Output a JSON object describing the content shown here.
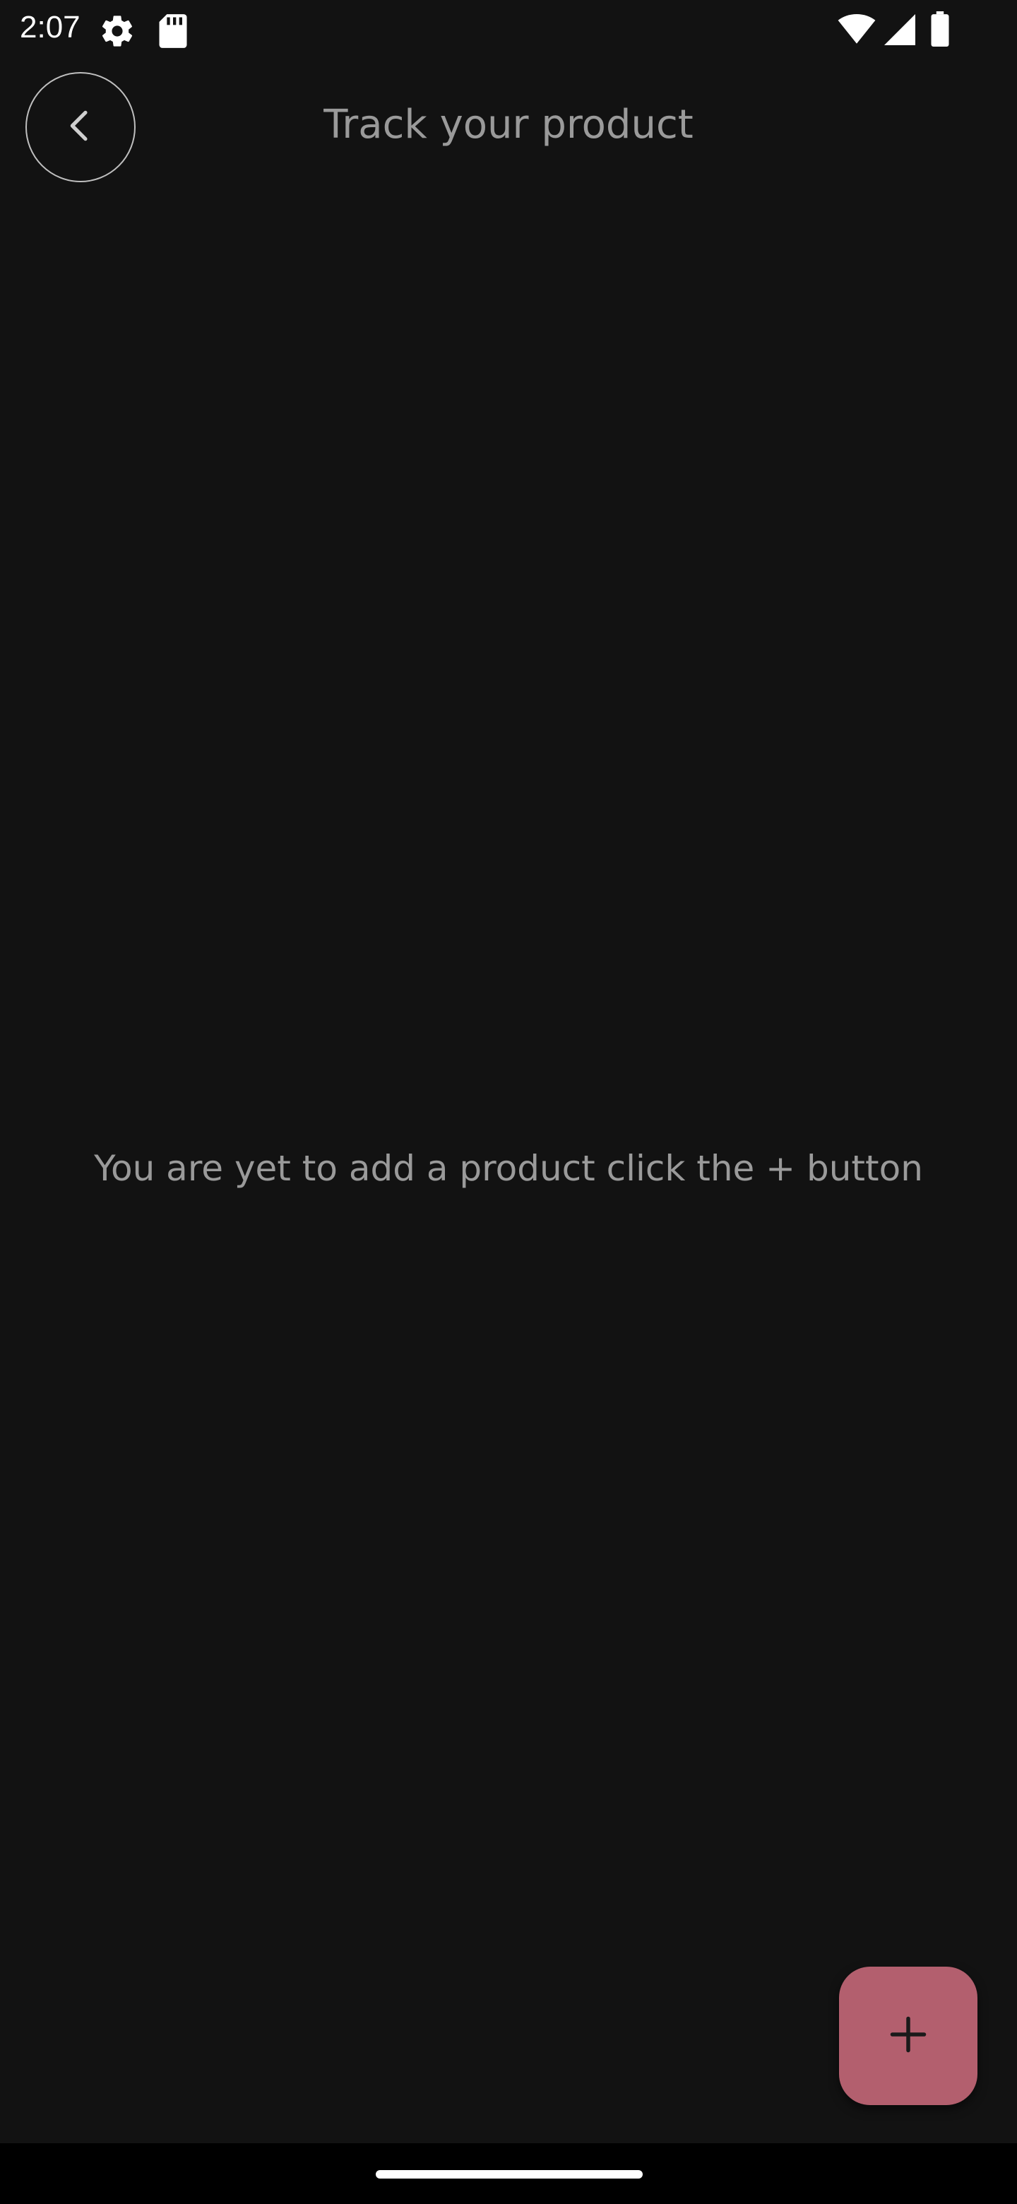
{
  "status_bar": {
    "time": "2:07",
    "icons": [
      "settings-gear-icon",
      "sd-card-icon",
      "wifi-icon",
      "cell-signal-icon",
      "battery-icon"
    ]
  },
  "header": {
    "back_icon": "chevron-left-icon",
    "title": "Track your product"
  },
  "main": {
    "empty_message": "You are yet to add a product click the + button"
  },
  "fab": {
    "icon": "plus-icon",
    "color": "#b35f6e"
  },
  "colors": {
    "background": "#121212",
    "text_muted": "#9a9a9a",
    "accent": "#b35f6e"
  }
}
